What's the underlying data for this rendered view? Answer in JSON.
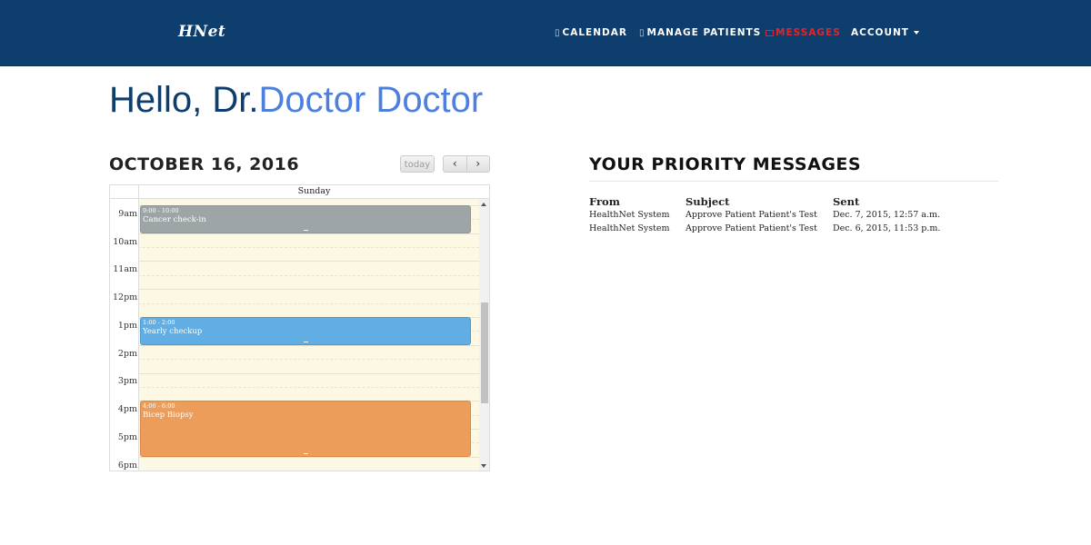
{
  "navbar": {
    "brand": "HNet",
    "items": [
      {
        "label": "CALENDAR",
        "icon": "calendar-icon"
      },
      {
        "label": "MANAGE PATIENTS",
        "icon": "patients-icon"
      },
      {
        "label": "MESSAGES",
        "icon": "envelope-icon",
        "color": "#e0262b"
      },
      {
        "label": "ACCOUNT",
        "icon": "caret-down-icon"
      }
    ],
    "background": "#0e3e6e"
  },
  "greeting": {
    "prefix": "Hello, Dr.",
    "name": "Doctor Doctor"
  },
  "calendar": {
    "date_title": "OCTOBER 16, 2016",
    "today_label": "today",
    "prev_label": "‹",
    "next_label": "›",
    "day_header": "Sunday",
    "time_labels": [
      "9am",
      "10am",
      "11am",
      "12pm",
      "1pm",
      "2pm",
      "3pm",
      "4pm",
      "5pm",
      "6pm"
    ],
    "events": [
      {
        "time": "9:00 - 10:00",
        "title": "Cancer check-in",
        "color": "#9ea5a6"
      },
      {
        "time": "1:00 - 2:00",
        "title": "Yearly checkup",
        "color": "#61aee4"
      },
      {
        "time": "4:00 - 6:00",
        "title": "Bicep Biopsy",
        "color": "#eb9d59"
      }
    ]
  },
  "messages": {
    "title": "YOUR PRIORITY MESSAGES",
    "columns": {
      "from": "From",
      "subject": "Subject",
      "sent": "Sent"
    },
    "rows": [
      {
        "from": "HealthNet System",
        "subject": "Approve Patient Patient's Test",
        "sent": "Dec. 7, 2015, 12:57 a.m."
      },
      {
        "from": "HealthNet System",
        "subject": "Approve Patient Patient's Test",
        "sent": "Dec. 6, 2015, 11:53 p.m."
      }
    ]
  }
}
